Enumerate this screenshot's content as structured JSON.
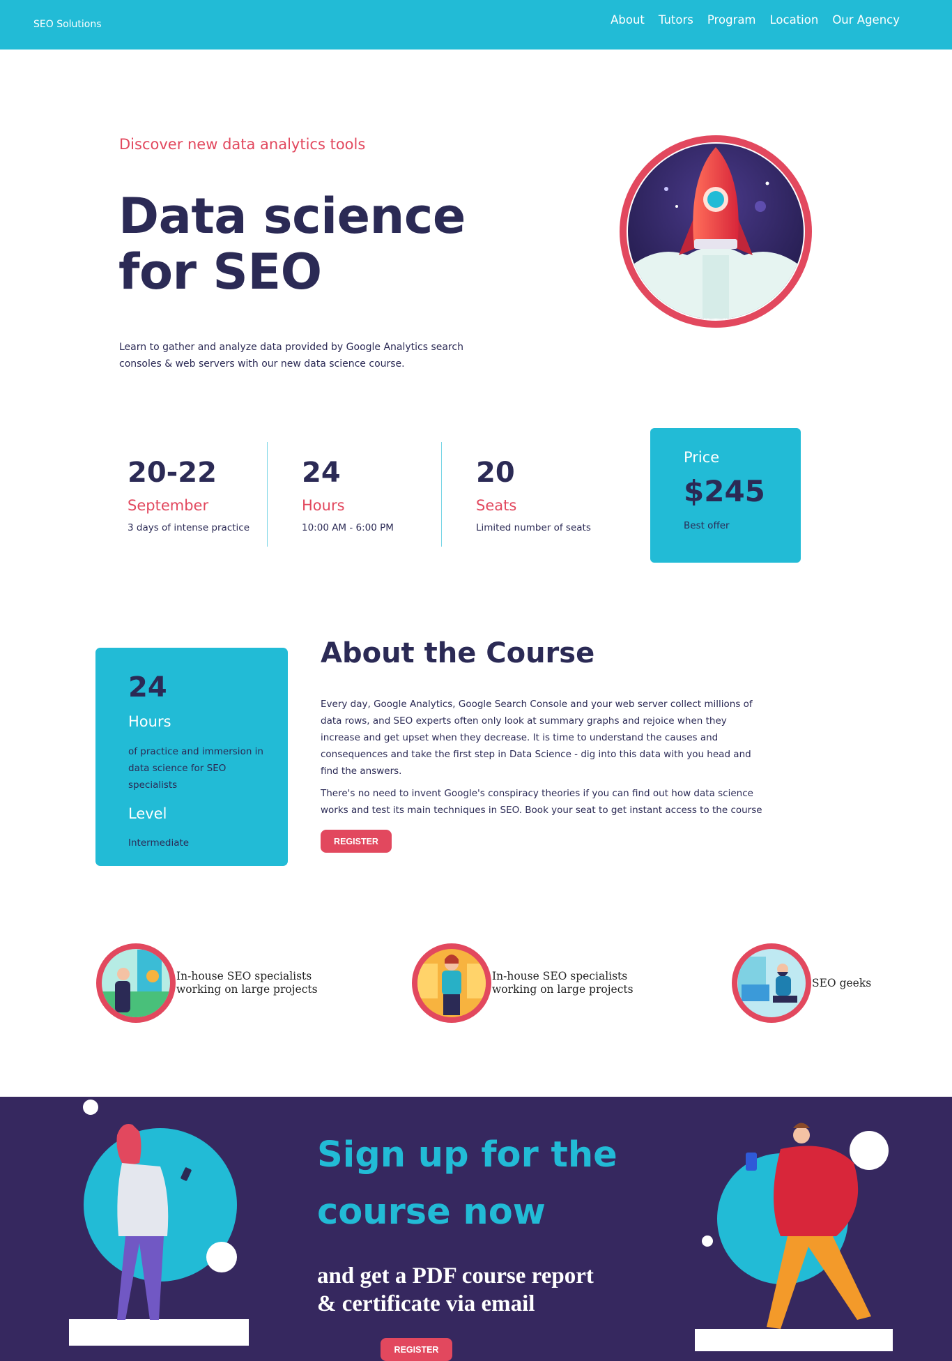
{
  "nav": {
    "brand": "SEO Solutions",
    "links": [
      "About",
      "Tutors",
      "Program",
      "Location",
      "Our Agency"
    ]
  },
  "hero": {
    "kicker": "Discover new data analytics tools",
    "title_line1": "Data science",
    "title_line2": "for SEO",
    "description": "Learn to gather and analyze data provided by Google Analytics search consoles & web servers with our new data science course.",
    "badge_icon": "rocket-icon"
  },
  "stats": [
    {
      "number": "20-22",
      "label": "September",
      "note": "3 days of intense practice"
    },
    {
      "number": "24",
      "label": "Hours",
      "note": "10:00 AM - 6:00 PM"
    },
    {
      "number": "20",
      "label": "Seats",
      "note": "Limited number of seats"
    }
  ],
  "price": {
    "label": "Price",
    "value": "$245",
    "note": "Best offer"
  },
  "info_card": {
    "number": "24",
    "label": "Hours",
    "description": "of practice and immersion in data science for SEO specialists",
    "level_label": "Level",
    "level_value": "Intermediate"
  },
  "about": {
    "title": "About the Course",
    "paragraph1": "Every day, Google Analytics, Google Search Console and your web server collect millions of data rows, and SEO experts often only look at summary graphs and rejoice when they increase and get upset when they decrease. It is time to understand the causes and consequences and take the first step in Data Science - dig into this data with you head and find the answers.",
    "paragraph2": "There's no need to invent Google's conspiracy theories if you can find out how data science works and test its main techniques in SEO. Book your seat to get instant access to the course",
    "register_label": "REGISTER"
  },
  "audience": [
    {
      "line1": "In-house SEO specialists",
      "line2": "working on large projects"
    },
    {
      "line1": "In-house SEO specialists",
      "line2": "working on large projects"
    },
    {
      "line1": "SEO geeks",
      "line2": ""
    }
  ],
  "signup": {
    "title_line1": "Sign up for the",
    "title_line2": "course now",
    "subtitle_line1": "and get a PDF course report",
    "subtitle_line2": "& certificate via email",
    "register_label": "REGISTER"
  },
  "colors": {
    "accent": "#22bbd6",
    "brand_red": "#e2485e",
    "navy": "#2b2a55",
    "signup_bg": "#36285f"
  }
}
